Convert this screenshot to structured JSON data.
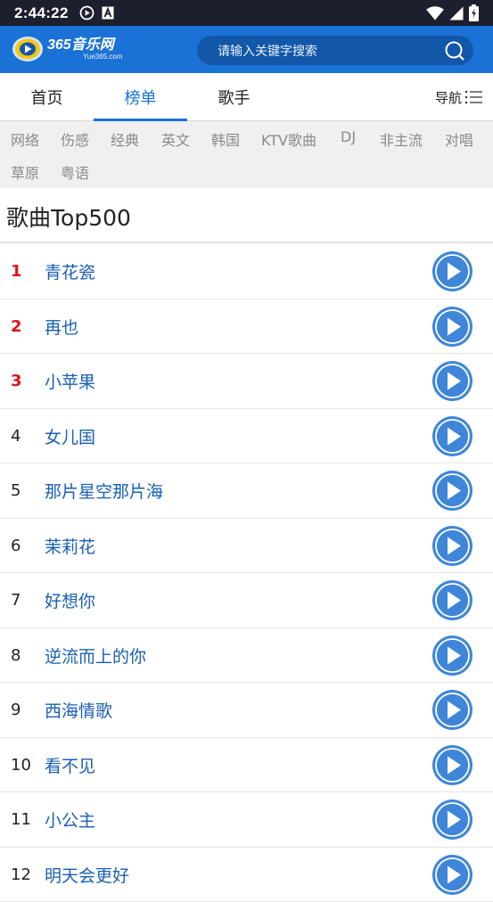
{
  "status_bar": {
    "time": "2:44:22",
    "icons": [
      "play-circle-icon",
      "a-box-icon",
      "wifi-icon",
      "signal-icon",
      "battery-icon"
    ]
  },
  "header": {
    "logo_text": "365音乐网",
    "logo_sub": "Yue365.com",
    "search_placeholder": "请输入关键字搜索"
  },
  "tabs": [
    {
      "label": "首页",
      "active": false
    },
    {
      "label": "榜单",
      "active": true
    },
    {
      "label": "歌手",
      "active": false
    }
  ],
  "nav_label": "导航",
  "categories": [
    "网络",
    "伤感",
    "经典",
    "英文",
    "韩国",
    "KTV歌曲",
    "DJ",
    "非主流",
    "对唱",
    "草原",
    "粤语"
  ],
  "section_title": "歌曲Top500",
  "songs": [
    {
      "rank": "1",
      "title": "青花瓷"
    },
    {
      "rank": "2",
      "title": "再也"
    },
    {
      "rank": "3",
      "title": "小苹果"
    },
    {
      "rank": "4",
      "title": "女儿国"
    },
    {
      "rank": "5",
      "title": "那片星空那片海"
    },
    {
      "rank": "6",
      "title": "茉莉花"
    },
    {
      "rank": "7",
      "title": "好想你"
    },
    {
      "rank": "8",
      "title": "逆流而上的你"
    },
    {
      "rank": "9",
      "title": "西海情歌"
    },
    {
      "rank": "10",
      "title": "看不见"
    },
    {
      "rank": "11",
      "title": "小公主"
    },
    {
      "rank": "12",
      "title": "明天会更好"
    }
  ],
  "colors": {
    "brand_blue": "#1a72d6",
    "link_blue": "#1a5fb4",
    "rank_red": "#e1131b",
    "play_blue": "#3f86d8",
    "status_bar": "#1d1f2e"
  }
}
